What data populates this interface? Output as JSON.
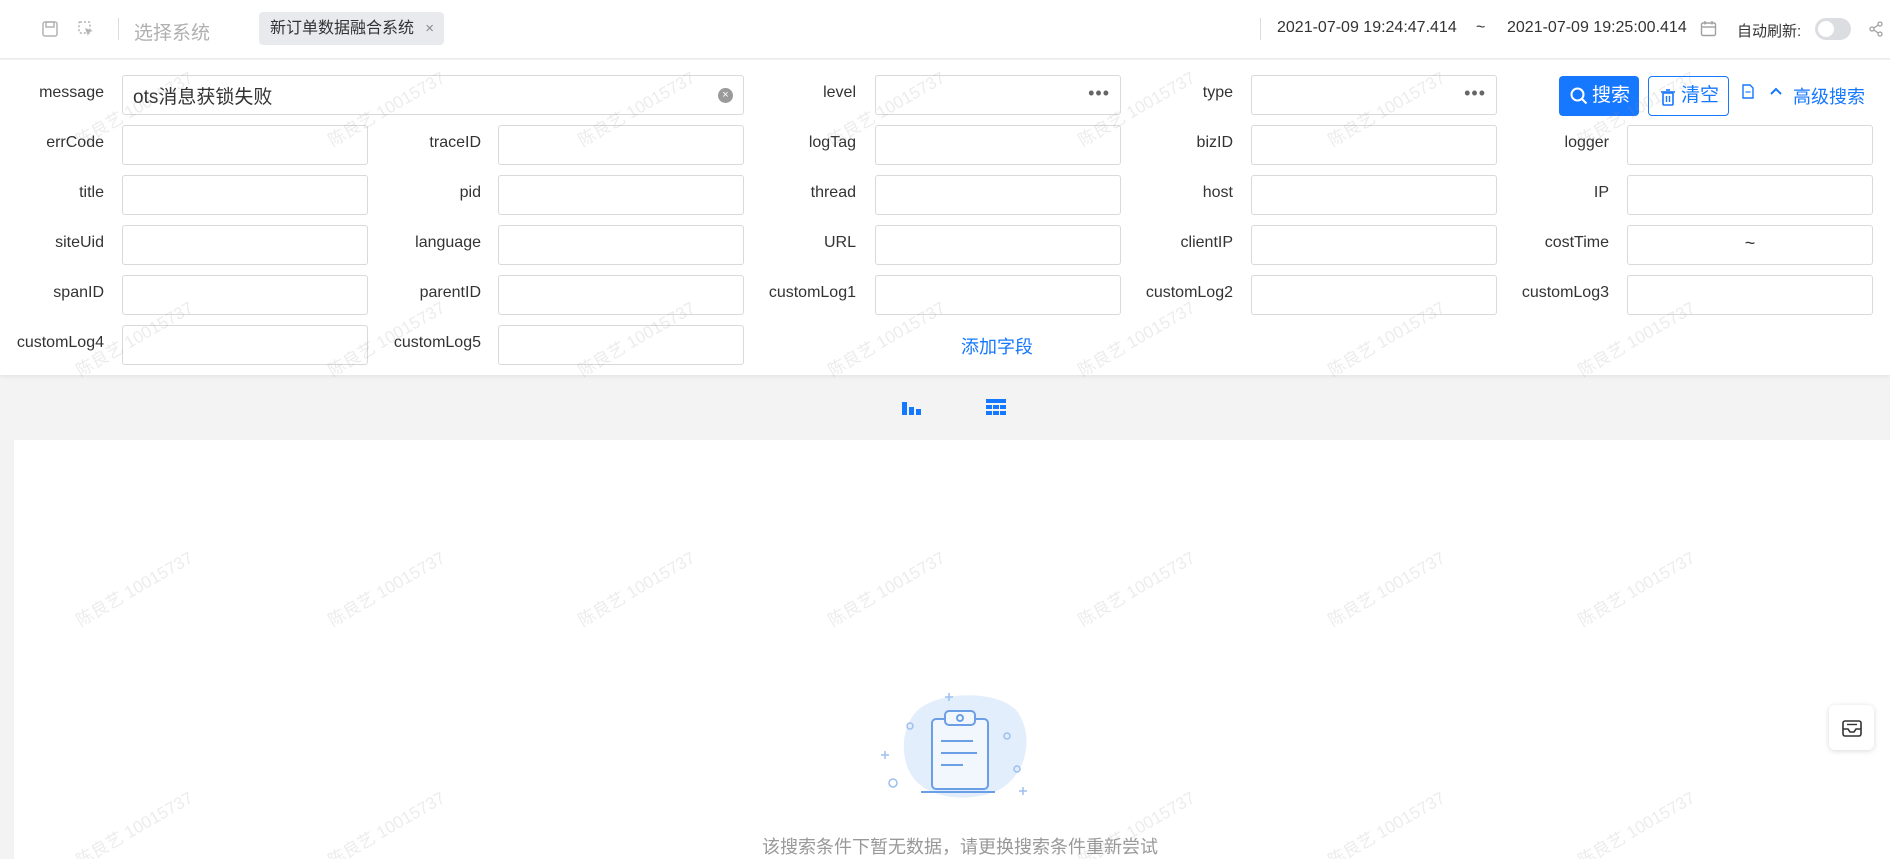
{
  "topbar": {
    "select_system": "选择系统",
    "current_system": "新订单数据融合系统",
    "close_symbol": "×",
    "time_start": "2021-07-09 19:24:47.414",
    "time_separator": "~",
    "time_end": "2021-07-09 19:25:00.414",
    "auto_refresh_label": "自动刷新:",
    "auto_refresh_on": false
  },
  "filters": {
    "message": {
      "label": "message",
      "value": "ots消息获锁失败"
    },
    "level": {
      "label": "level"
    },
    "type": {
      "label": "type"
    },
    "errCode": {
      "label": "errCode"
    },
    "traceID": {
      "label": "traceID"
    },
    "logTag": {
      "label": "logTag"
    },
    "bizID": {
      "label": "bizID"
    },
    "logger": {
      "label": "logger"
    },
    "title": {
      "label": "title"
    },
    "pid": {
      "label": "pid"
    },
    "thread": {
      "label": "thread"
    },
    "host": {
      "label": "host"
    },
    "IP": {
      "label": "IP"
    },
    "siteUid": {
      "label": "siteUid"
    },
    "language": {
      "label": "language"
    },
    "URL": {
      "label": "URL"
    },
    "clientIP": {
      "label": "clientIP"
    },
    "costTime": {
      "label": "costTime",
      "separator": "~"
    },
    "spanID": {
      "label": "spanID"
    },
    "parentID": {
      "label": "parentID"
    },
    "customLog1": {
      "label": "customLog1"
    },
    "customLog2": {
      "label": "customLog2"
    },
    "customLog3": {
      "label": "customLog3"
    },
    "customLog4": {
      "label": "customLog4"
    },
    "customLog5": {
      "label": "customLog5"
    }
  },
  "actions": {
    "search_label": "搜索",
    "clear_label": "清空",
    "advanced_search_label": "高级搜索",
    "add_field_label": "添加字段"
  },
  "results": {
    "empty_text": "该搜索条件下暂无数据，请更换搜索条件重新尝试"
  },
  "watermark": "陈良艺 10015737",
  "colors": {
    "primary": "#1677ff",
    "muted_text": "#999999"
  }
}
